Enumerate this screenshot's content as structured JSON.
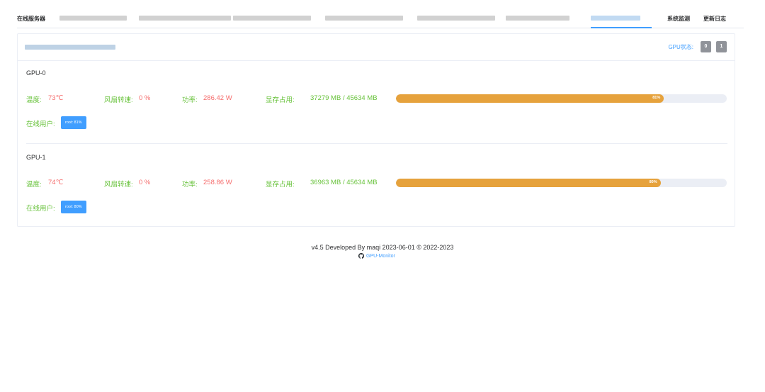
{
  "nav": {
    "label": "在线服务器",
    "links": [
      "系统监测",
      "更新日志"
    ]
  },
  "card": {
    "gpu_status_label": "GPU状态:",
    "gpu_status_buttons": [
      "0",
      "1"
    ]
  },
  "gpus": [
    {
      "title": "GPU-0",
      "temp_label": "温度:",
      "temp_value": "73℃",
      "fan_label": "风扇转速:",
      "fan_value": "0 %",
      "power_label": "功率:",
      "power_value": "286.42 W",
      "mem_label": "显存占用:",
      "mem_value": "37279 MB / 45634 MB",
      "mem_percent": 81,
      "mem_percent_text": "81%",
      "user_label": "在线用户:",
      "user_tag": "root: 81%"
    },
    {
      "title": "GPU-1",
      "temp_label": "温度:",
      "temp_value": "74℃",
      "fan_label": "风扇转速:",
      "fan_value": "0 %",
      "power_label": "功率:",
      "power_value": "258.86 W",
      "mem_label": "显存占用:",
      "mem_value": "36963 MB / 45634 MB",
      "mem_percent": 80,
      "mem_percent_text": "80%",
      "user_label": "在线用户:",
      "user_tag": "root: 80%"
    }
  ],
  "footer": {
    "text": "v4.5 Developed By maqi 2023-06-01 © 2022-2023",
    "link": "GPU-Monitor"
  },
  "colors": {
    "accent": "#409eff",
    "success": "#67c23a",
    "danger": "#f56c6c",
    "warning": "#e6a23c"
  }
}
